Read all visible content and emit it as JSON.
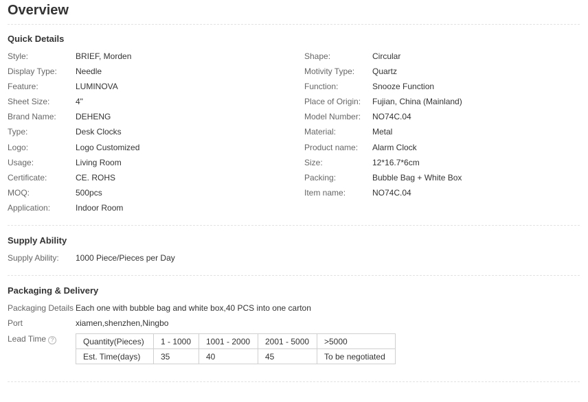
{
  "page": {
    "title": "Overview"
  },
  "quick_details": {
    "heading": "Quick Details",
    "left": [
      {
        "label": "Style:",
        "value": "BRIEF, Morden"
      },
      {
        "label": "Display Type:",
        "value": "Needle"
      },
      {
        "label": "Feature:",
        "value": "LUMINOVA"
      },
      {
        "label": "Sheet Size:",
        "value": "4\""
      },
      {
        "label": "Brand Name:",
        "value": "DEHENG"
      },
      {
        "label": "Type:",
        "value": "Desk Clocks"
      },
      {
        "label": "Logo:",
        "value": "Logo Customized"
      },
      {
        "label": "Usage:",
        "value": "Living Room"
      },
      {
        "label": "Certificate:",
        "value": "CE. ROHS"
      },
      {
        "label": "MOQ:",
        "value": "500pcs"
      },
      {
        "label": "Application:",
        "value": "Indoor Room"
      }
    ],
    "right": [
      {
        "label": "Shape:",
        "value": "Circular"
      },
      {
        "label": "Motivity Type:",
        "value": "Quartz"
      },
      {
        "label": "Function:",
        "value": "Snooze Function"
      },
      {
        "label": "Place of Origin:",
        "value": "Fujian, China (Mainland)"
      },
      {
        "label": "Model Number:",
        "value": "NO74C.04"
      },
      {
        "label": "Material:",
        "value": "Metal"
      },
      {
        "label": "Product name:",
        "value": "Alarm Clock"
      },
      {
        "label": "Size:",
        "value": "12*16.7*6cm"
      },
      {
        "label": "Packing:",
        "value": "Bubble Bag + White Box"
      },
      {
        "label": "Item name:",
        "value": "NO74C.04"
      }
    ]
  },
  "supply_ability": {
    "heading": "Supply Ability",
    "label": "Supply Ability:",
    "value": "1000 Piece/Pieces per Day"
  },
  "packaging_delivery": {
    "heading": "Packaging & Delivery",
    "packaging_label": "Packaging Details",
    "packaging_value": "Each one with bubble bag and white box,40 PCS into one carton",
    "port_label": "Port",
    "port_value": "xiamen,shenzhen,Ningbo",
    "lead_time_label": "Lead Time",
    "help_icon": "question-mark-circle",
    "lead_table": {
      "row1": [
        "Quantity(Pieces)",
        "1 - 1000",
        "1001 - 2000",
        "2001 - 5000",
        ">5000"
      ],
      "row2": [
        "Est. Time(days)",
        "35",
        "40",
        "45",
        "To be negotiated"
      ]
    }
  }
}
